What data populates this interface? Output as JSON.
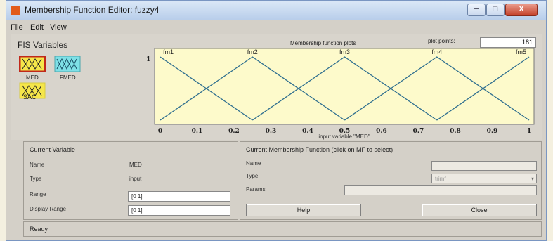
{
  "window": {
    "title": "Membership Function Editor: fuzzy4",
    "controls": {
      "minimize": "─",
      "maximize": "□",
      "close": "X"
    }
  },
  "menu": {
    "items": [
      "File",
      "Edit",
      "View"
    ]
  },
  "fis": {
    "label": "FIS Variables",
    "variables": [
      {
        "name": "MED",
        "selected": true
      },
      {
        "name": "FMED",
        "selected": false
      },
      {
        "name": "SAC",
        "selected": false
      }
    ]
  },
  "plot": {
    "title": "Membership function plots",
    "points_label": "plot points:",
    "points_value": "181",
    "y_tick": "1",
    "x_ticks": [
      "0",
      "0.1",
      "0.2",
      "0.3",
      "0.4",
      "0.5",
      "0.6",
      "0.7",
      "0.8",
      "0.9",
      "1"
    ],
    "xlabel": "input variable \"MED\"",
    "mf_labels": [
      "fm1",
      "fm2",
      "fm3",
      "fm4",
      "fm5"
    ],
    "background": "#fdfacb",
    "line_color": "#2f6f8f"
  },
  "chart_data": {
    "type": "line",
    "xlim": [
      0,
      1
    ],
    "ylim": [
      0,
      1
    ],
    "series": [
      {
        "name": "fm1",
        "x": [
          0,
          0.25
        ],
        "y": [
          1,
          0
        ]
      },
      {
        "name": "fm2",
        "x": [
          0,
          0.25,
          0.5
        ],
        "y": [
          0,
          1,
          0
        ]
      },
      {
        "name": "fm3",
        "x": [
          0.25,
          0.5,
          0.75
        ],
        "y": [
          0,
          1,
          0
        ]
      },
      {
        "name": "fm4",
        "x": [
          0.5,
          0.75,
          1
        ],
        "y": [
          0,
          1,
          0
        ]
      },
      {
        "name": "fm5",
        "x": [
          0.75,
          1
        ],
        "y": [
          0,
          1
        ]
      }
    ]
  },
  "current_variable": {
    "title": "Current Variable",
    "name_label": "Name",
    "name_value": "MED",
    "type_label": "Type",
    "type_value": "input",
    "range_label": "Range",
    "range_value": "[0 1]",
    "display_range_label": "Display Range",
    "display_range_value": "[0 1]"
  },
  "current_mf": {
    "title": "Current Membership Function (click on MF to select)",
    "name_label": "Name",
    "name_value": "",
    "type_label": "Type",
    "type_value": "trimf",
    "params_label": "Params",
    "params_value": ""
  },
  "buttons": {
    "help": "Help",
    "close": "Close"
  },
  "status": "Ready"
}
